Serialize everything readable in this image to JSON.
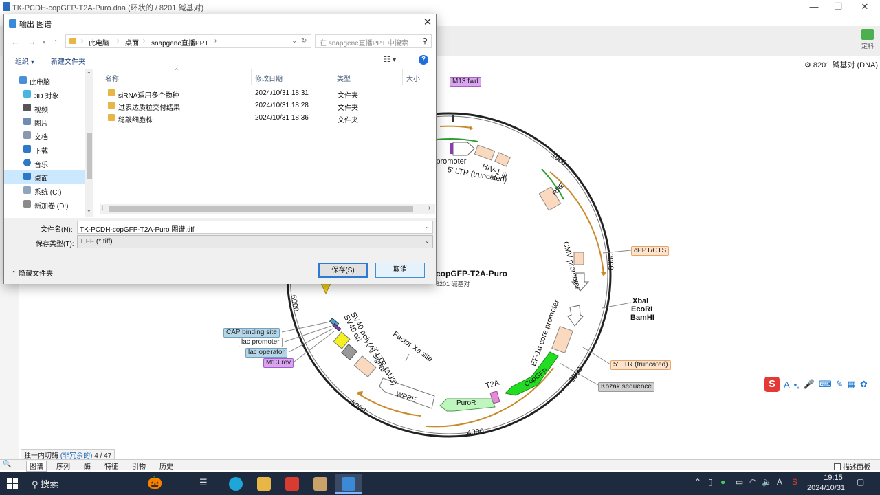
{
  "app": {
    "title": "TK-PCDH-copGFP-T2A-Puro.dna  (环状的 / 8201 碱基对)",
    "order_label": "定料",
    "info": "8201 碱基对 (DNA)",
    "status": {
      "prefix": "独一内切酶",
      "highlight": "(非冗余的)",
      "count": "4 / 47"
    },
    "bottom_tabs": [
      "图谱",
      "序列",
      "酶",
      "特征",
      "引物",
      "历史"
    ],
    "description_panel": "描述面板"
  },
  "map": {
    "plasmid_name": "copGFP-T2A-Puro",
    "size": "8201 碱基对",
    "ticks": [
      "1000",
      "2000",
      "3000",
      "4000",
      "5000",
      "6000"
    ],
    "features": {
      "m13_fwd": "M13 fwd",
      "cppt": "cPPT/CTS",
      "ltr5": "5' LTR (truncated)",
      "kozak": "Kozak sequence",
      "cap": "CAP binding site",
      "lac_promoter": "lac promoter",
      "lac_operator": "lac operator",
      "m13_rev": "M13 rev"
    },
    "enzymes": [
      "XbaI",
      "EcoRI",
      "BamHI"
    ],
    "arc_labels": {
      "rsv": "V promoter",
      "ltr5_trunc": "5' LTR (truncated)",
      "hiv": "HIV-1 ψ",
      "rre": "RRE",
      "cmv": "CMV promoter",
      "ef1a": "EF-1α core promoter",
      "copgfp": "CopGFP",
      "t2a": "T2A",
      "puror": "PuroR",
      "wpre": "WPRE",
      "ltr3": "3' LTR (ΔU3)",
      "sv40_polya": "SV40 poly(A) signal",
      "sv40_ori": "SV40 ori",
      "factor_xa": "Factor Xa site"
    }
  },
  "dialog": {
    "title": "输出 图谱",
    "breadcrumb": [
      "此电脑",
      "桌面",
      "snapgene直播PPT"
    ],
    "search_placeholder": "在 snapgene直播PPT 中搜索",
    "organize": "组织 ▾",
    "new_folder": "新建文件夹",
    "nav_items": [
      {
        "label": "此电脑",
        "icon": "computer-icon"
      },
      {
        "label": "3D 对象",
        "icon": "cube-icon"
      },
      {
        "label": "视频",
        "icon": "video-icon"
      },
      {
        "label": "图片",
        "icon": "picture-icon"
      },
      {
        "label": "文档",
        "icon": "document-icon"
      },
      {
        "label": "下载",
        "icon": "download-icon"
      },
      {
        "label": "音乐",
        "icon": "music-icon"
      },
      {
        "label": "桌面",
        "icon": "desktop-icon"
      },
      {
        "label": "系统 (C:)",
        "icon": "drive-icon"
      },
      {
        "label": "新加卷 (D:)",
        "icon": "drive-icon"
      }
    ],
    "columns": [
      "名称",
      "修改日期",
      "类型",
      "大小"
    ],
    "files": [
      {
        "name": "siRNA适用多个物种",
        "date": "2024/10/31 18:31",
        "type": "文件夹"
      },
      {
        "name": "过表达质粒交付结果",
        "date": "2024/10/31 18:28",
        "type": "文件夹"
      },
      {
        "name": "稳敲细胞株",
        "date": "2024/10/31 18:36",
        "type": "文件夹"
      }
    ],
    "filename_label": "文件名(N):",
    "filename_value": "TK-PCDH-copGFP-T2A-Puro 图谱.tiff",
    "filetype_label": "保存类型(T):",
    "filetype_value": "TIFF (*.tiff)",
    "save": "保存(S)",
    "cancel": "取消",
    "hide_folders": "隐藏文件夹"
  },
  "taskbar": {
    "search": "搜索",
    "time": "19:15",
    "date": "2024/10/31"
  },
  "colors": {
    "accent": "#2b7bd6",
    "feature_orange": "#fde3cc",
    "copgfp_green": "#22dd22",
    "taskbar": "#1e2a3e"
  }
}
